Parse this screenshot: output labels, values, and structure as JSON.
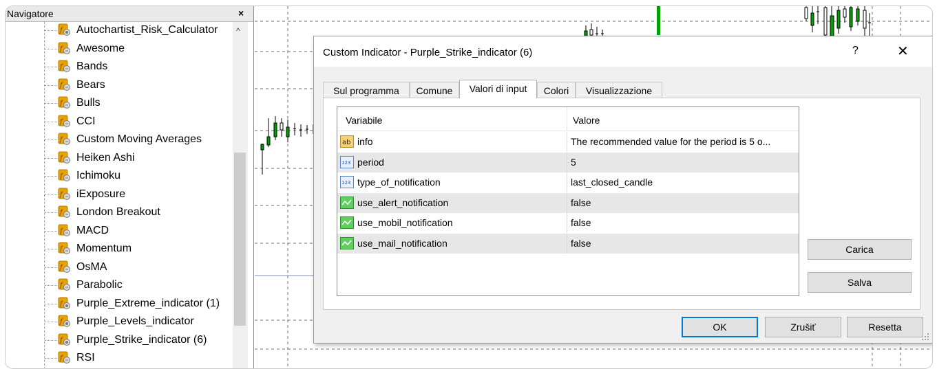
{
  "navigator": {
    "title": "Navigatore",
    "close": "×",
    "scroll_up": "^",
    "items": [
      {
        "label": "Autochartist_Risk_Calculator",
        "icon": "custom-indicator-icon"
      },
      {
        "label": "Awesome",
        "icon": "indicator-icon"
      },
      {
        "label": "Bands",
        "icon": "indicator-icon"
      },
      {
        "label": "Bears",
        "icon": "indicator-icon"
      },
      {
        "label": "Bulls",
        "icon": "indicator-icon"
      },
      {
        "label": "CCI",
        "icon": "indicator-icon"
      },
      {
        "label": "Custom Moving Averages",
        "icon": "indicator-icon"
      },
      {
        "label": "Heiken Ashi",
        "icon": "indicator-icon"
      },
      {
        "label": "Ichimoku",
        "icon": "indicator-icon"
      },
      {
        "label": "iExposure",
        "icon": "indicator-icon"
      },
      {
        "label": "London Breakout",
        "icon": "indicator-icon"
      },
      {
        "label": "MACD",
        "icon": "indicator-icon"
      },
      {
        "label": "Momentum",
        "icon": "indicator-icon"
      },
      {
        "label": "OsMA",
        "icon": "indicator-icon"
      },
      {
        "label": "Parabolic",
        "icon": "indicator-icon"
      },
      {
        "label": "Purple_Extreme_indicator (1)",
        "icon": "custom-indicator-icon"
      },
      {
        "label": "Purple_Levels_indicator",
        "icon": "custom-indicator-icon"
      },
      {
        "label": "Purple_Strike_indicator (6)",
        "icon": "custom-indicator-icon"
      },
      {
        "label": "RSI",
        "icon": "indicator-icon"
      }
    ]
  },
  "dialog": {
    "title": "Custom Indicator - Purple_Strike_indicator (6)",
    "help": "?",
    "close": "✕",
    "tabs": [
      {
        "label": "Sul programma",
        "active": false
      },
      {
        "label": "Comune",
        "active": false
      },
      {
        "label": "Valori di input",
        "active": true
      },
      {
        "label": "Colori",
        "active": false
      },
      {
        "label": "Visualizzazione",
        "active": false
      }
    ],
    "grid": {
      "col_variable": "Variabile",
      "col_value": "Valore",
      "rows": [
        {
          "name": "info",
          "value": "The recommended value for the period is 5 o...",
          "type": "string"
        },
        {
          "name": "period",
          "value": "5",
          "type": "integer"
        },
        {
          "name": "type_of_notification",
          "value": "last_closed_candle",
          "type": "integer"
        },
        {
          "name": "use_alert_notification",
          "value": "false",
          "type": "boolean"
        },
        {
          "name": "use_mobil_notification",
          "value": "false",
          "type": "boolean"
        },
        {
          "name": "use_mail_notification",
          "value": "false",
          "type": "boolean"
        }
      ]
    },
    "buttons": {
      "load": "Carica",
      "save": "Salva",
      "ok": "OK",
      "cancel": "Zrušiť",
      "reset": "Resetta"
    },
    "type_icons": {
      "string": "ab",
      "integer": "123"
    }
  },
  "colors": {
    "candle_green": "#00a000",
    "chart_grid": "#6e6e6e",
    "default_button_border": "#0078d7",
    "indicator_icon": "#e7a400"
  }
}
